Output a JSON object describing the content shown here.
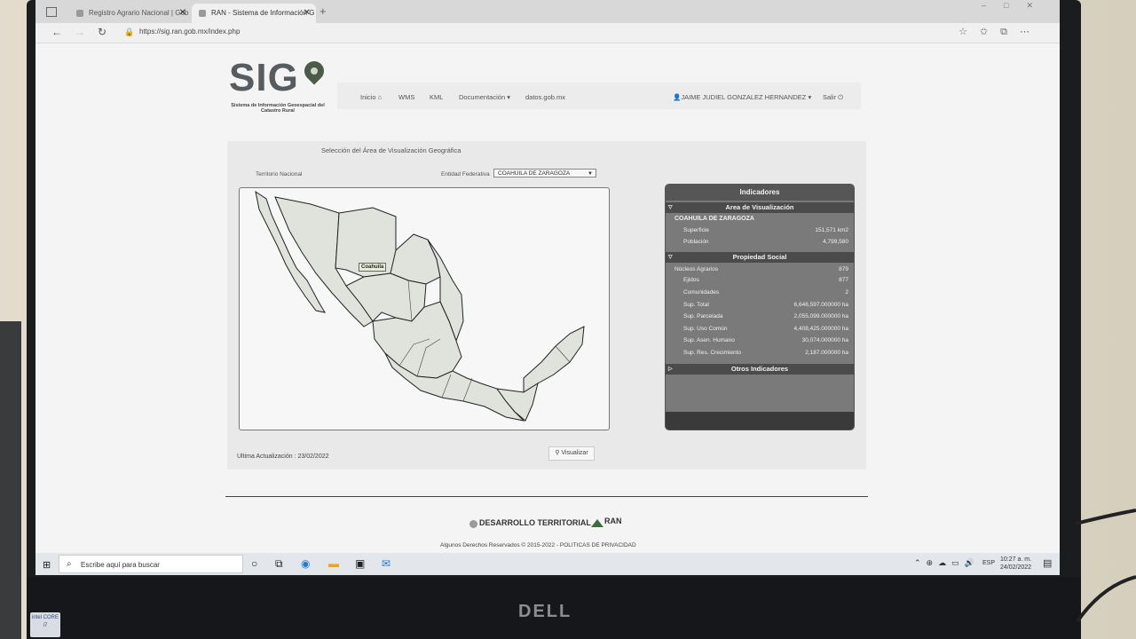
{
  "browser": {
    "tabs": [
      {
        "label": "Registro Agrario Nacional | Gob"
      },
      {
        "label": "RAN - Sistema de Información G"
      }
    ],
    "url": "https://sig.ran.gob.mx/index.php"
  },
  "site": {
    "logo": "SIG",
    "logo_subtitle": "Sistema de Información Geoespacial del Catastro Rural",
    "menu": {
      "inicio": "Inicio",
      "wms": "WMS",
      "kml": "KML",
      "documentacion": "Documentación",
      "datos": "datos.gob.mx",
      "user": "JAIME JUDIEL GONZALEZ HERNANDEZ",
      "salir": "Salir"
    }
  },
  "selector": {
    "title": "Selección del Área de Visualización Geográfica",
    "territorio": "Territorio Nacional",
    "entidad_label": "Entidad Federativa",
    "entidad_value": "COAHUILA DE ZARAGOZA",
    "map_label": "Coahuila",
    "last_update": "Ultima Actualización : 23/02/2022",
    "visualizar": "Visualizar"
  },
  "indicadores": {
    "header": "Indicadores",
    "area_title": "Area de Visualización",
    "state": "COAHUILA DE ZARAGOZA",
    "area_rows": [
      {
        "label": "Superficie",
        "value": "151,571 km2"
      },
      {
        "label": "Población",
        "value": "4,799,580"
      }
    ],
    "prop_title": "Propiedad Social",
    "prop_rows": [
      {
        "label": "Núcleos Agrarios",
        "value": "879"
      },
      {
        "label": "Ejidos",
        "value": "877"
      },
      {
        "label": "Comunidades",
        "value": "2"
      },
      {
        "label": "Sup. Total",
        "value": "6,646,597.000000 ha"
      },
      {
        "label": "Sup. Parcelada",
        "value": "2,055,099.000000 ha"
      },
      {
        "label": "Sup. Uso Común",
        "value": "4,408,425.000000 ha"
      },
      {
        "label": "Sup. Asen. Humano",
        "value": "30,074.000000 ha"
      },
      {
        "label": "Sup. Res. Crecimiento",
        "value": "2,187.000000 ha"
      }
    ],
    "otros_title": "Otros Indicadores"
  },
  "footer": {
    "desarrollo": "DESARROLLO TERRITORIAL",
    "ran": "RAN",
    "copyright": "Algunos Derechos Reservados © 2015-2022 - POLITICAS DE PRIVACIDAD"
  },
  "taskbar": {
    "search_placeholder": "Escribe aquí para buscar",
    "lang": "ESP",
    "time": "10:27 a. m.",
    "date": "24/02/2022"
  },
  "hardware": {
    "brand": "DELL",
    "sticker": "intel CORE i7"
  }
}
